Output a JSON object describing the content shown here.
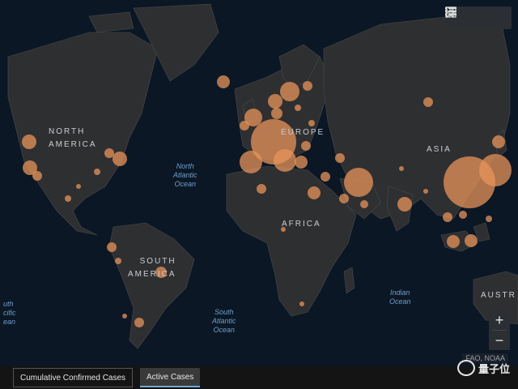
{
  "map": {
    "continents": [
      {
        "id": "north-america",
        "text": "NORTH\nAMERICA"
      },
      {
        "id": "europe",
        "text": "EUROPE"
      },
      {
        "id": "asia",
        "text": "ASIA"
      },
      {
        "id": "africa",
        "text": "AFRICA"
      },
      {
        "id": "south-america",
        "text": "SOUTH\nAMERICA"
      },
      {
        "id": "australia",
        "text": "AUSTR"
      }
    ],
    "oceans": [
      {
        "id": "north-atlantic",
        "text": "North\nAtlantic\nOcean"
      },
      {
        "id": "indian",
        "text": "Indian\nOcean"
      },
      {
        "id": "south-atlantic",
        "text": "South\nAtlantic\nOcean"
      },
      {
        "id": "pacific",
        "text": "uth\ncific\nean"
      }
    ],
    "attribution": "FAO, NOAA",
    "watermark": "量子位",
    "colors": {
      "land": "#2e2f31",
      "ocean": "#0b1724",
      "bubble": "#e8945a",
      "border": "#555"
    }
  },
  "toolbar": {
    "icons": [
      "bookmark-icon",
      "list-icon",
      "qr-grid-icon"
    ]
  },
  "zoom": {
    "in": "+",
    "out": "−"
  },
  "tabs": {
    "cumulative": "Cumulative Confirmed Cases",
    "active": "Active Cases"
  }
}
